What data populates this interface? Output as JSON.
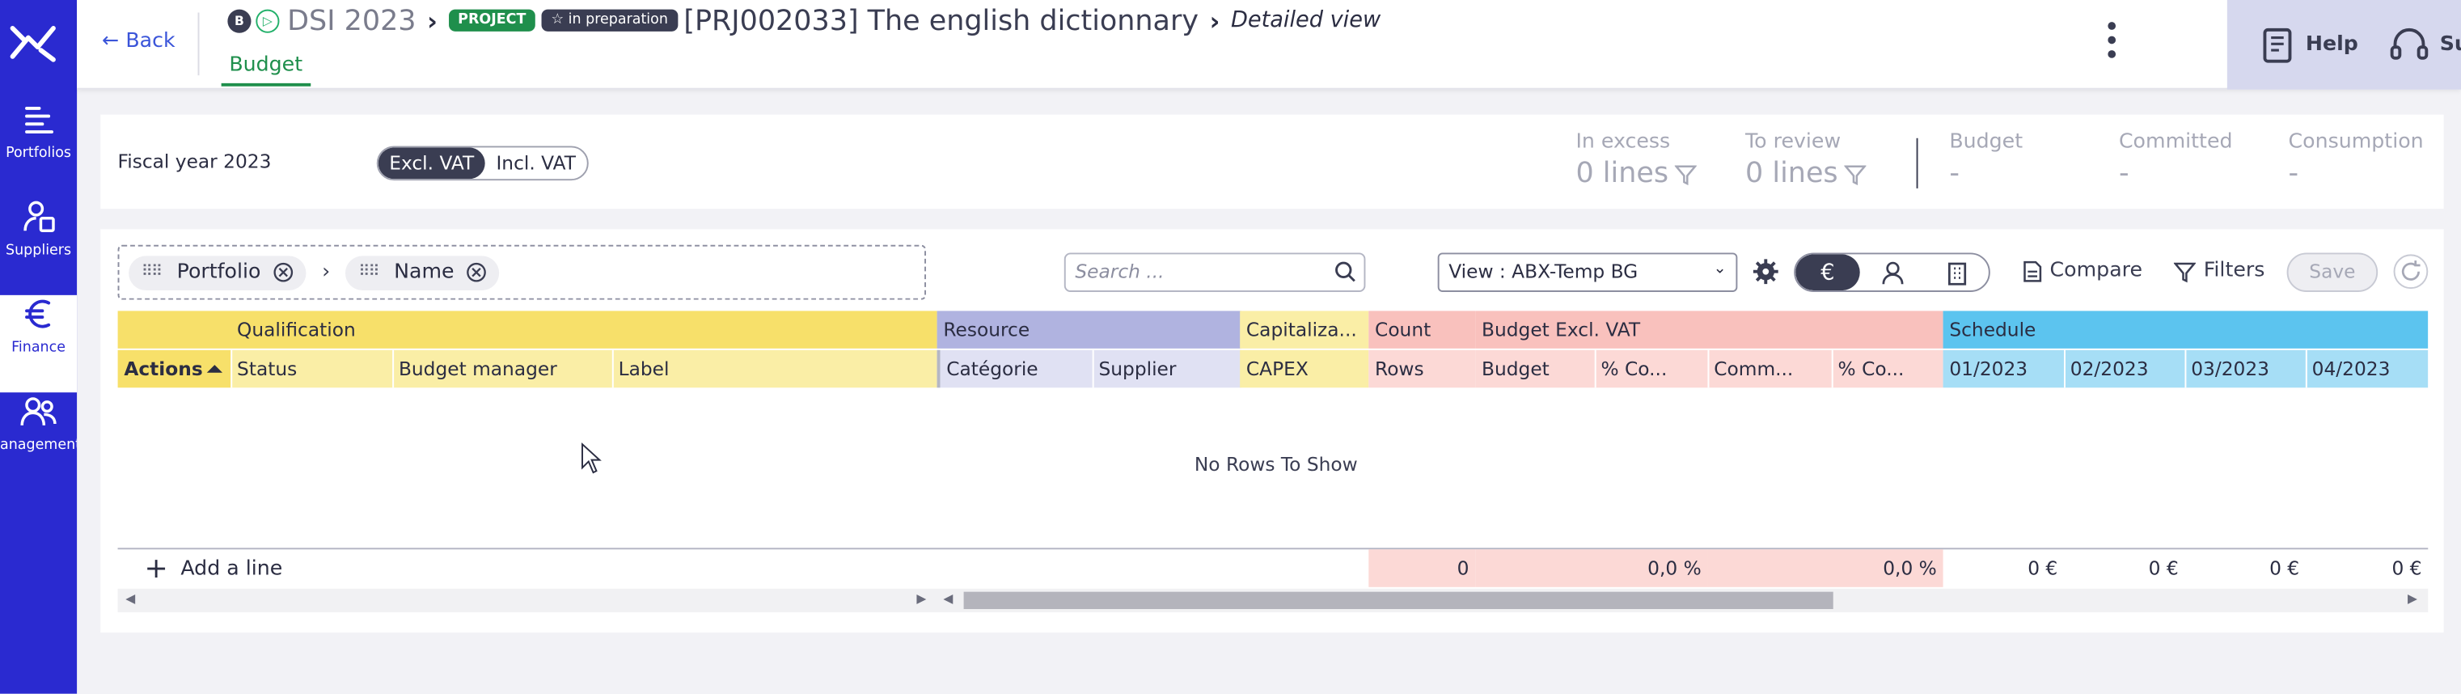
{
  "nav": {
    "items": [
      {
        "label": "Portfolios"
      },
      {
        "label": "Suppliers"
      },
      {
        "label": "Finance",
        "icon": "euro-icon"
      },
      {
        "label": "anagement"
      }
    ]
  },
  "header": {
    "back_label": "Back",
    "circle_b": "B",
    "circle_play": "▷",
    "portfolio": "DSI 2023",
    "badge_type": "PROJECT",
    "badge_status": "☆ in preparation",
    "project_title": "[PRJ002033] The english dictionnary",
    "view_label": "Detailed view",
    "active_tab": "Budget"
  },
  "help": {
    "help_label": "Help",
    "support_label": "Support"
  },
  "summary": {
    "fiscal_year": "Fiscal year 2023",
    "vat_excl": "Excl. VAT",
    "vat_incl": "Incl. VAT",
    "in_excess_label": "In excess",
    "in_excess_value": "0  lines",
    "to_review_label": "To review",
    "to_review_value": "0  lines",
    "budget_label": "Budget",
    "budget_value": "-",
    "committed_label": "Committed",
    "committed_value": "-",
    "consumption_label": "Consumption",
    "consumption_value": "-"
  },
  "toolbar": {
    "group_chip_1": "Portfolio",
    "group_chip_2": "Name",
    "search_placeholder": "Search ...",
    "view_select": "View : ABX-Temp BG",
    "compare_label": "Compare",
    "filters_label": "Filters",
    "save_label": "Save"
  },
  "grid": {
    "groups": {
      "qualification": "Qualification",
      "resource": "Resource",
      "capitalization": "Capitaliza...",
      "count": "Count",
      "budget_excl": "Budget Excl. VAT",
      "schedule": "Schedule"
    },
    "columns": {
      "actions": "Actions",
      "status": "Status",
      "budget_manager": "Budget manager",
      "label": "Label",
      "categorie": "Catégorie",
      "supplier": "Supplier",
      "capex": "CAPEX",
      "rows": "Rows",
      "budget": "Budget",
      "pct_co_1": "% Co...",
      "comm": "Comm...",
      "pct_co_2": "% Co...",
      "m01": "01/2023",
      "m02": "02/2023",
      "m03": "03/2023",
      "m04": "04/2023"
    },
    "empty_message": "No Rows To Show",
    "add_line": "Add a line",
    "totals": {
      "rows": "0",
      "pct_1": "0,0 %",
      "pct_2": "0,0 %",
      "m01": "0 €",
      "m02": "0 €",
      "m03": "0 €",
      "m04": "0 €"
    }
  },
  "colors": {
    "nav_bg": "#2a2ad0",
    "accent_green": "#1f8f4c",
    "qualification_group": "#f7e06a",
    "qualification_col": "#faeea6",
    "resource_group": "#b0b3e0",
    "resource_col": "#e0e1f3",
    "capex": "#faeea6",
    "budget_group": "#f9c1bd",
    "budget_col": "#fcd9d6",
    "schedule_group": "#5cc4ef",
    "schedule_col": "#a6def6"
  }
}
